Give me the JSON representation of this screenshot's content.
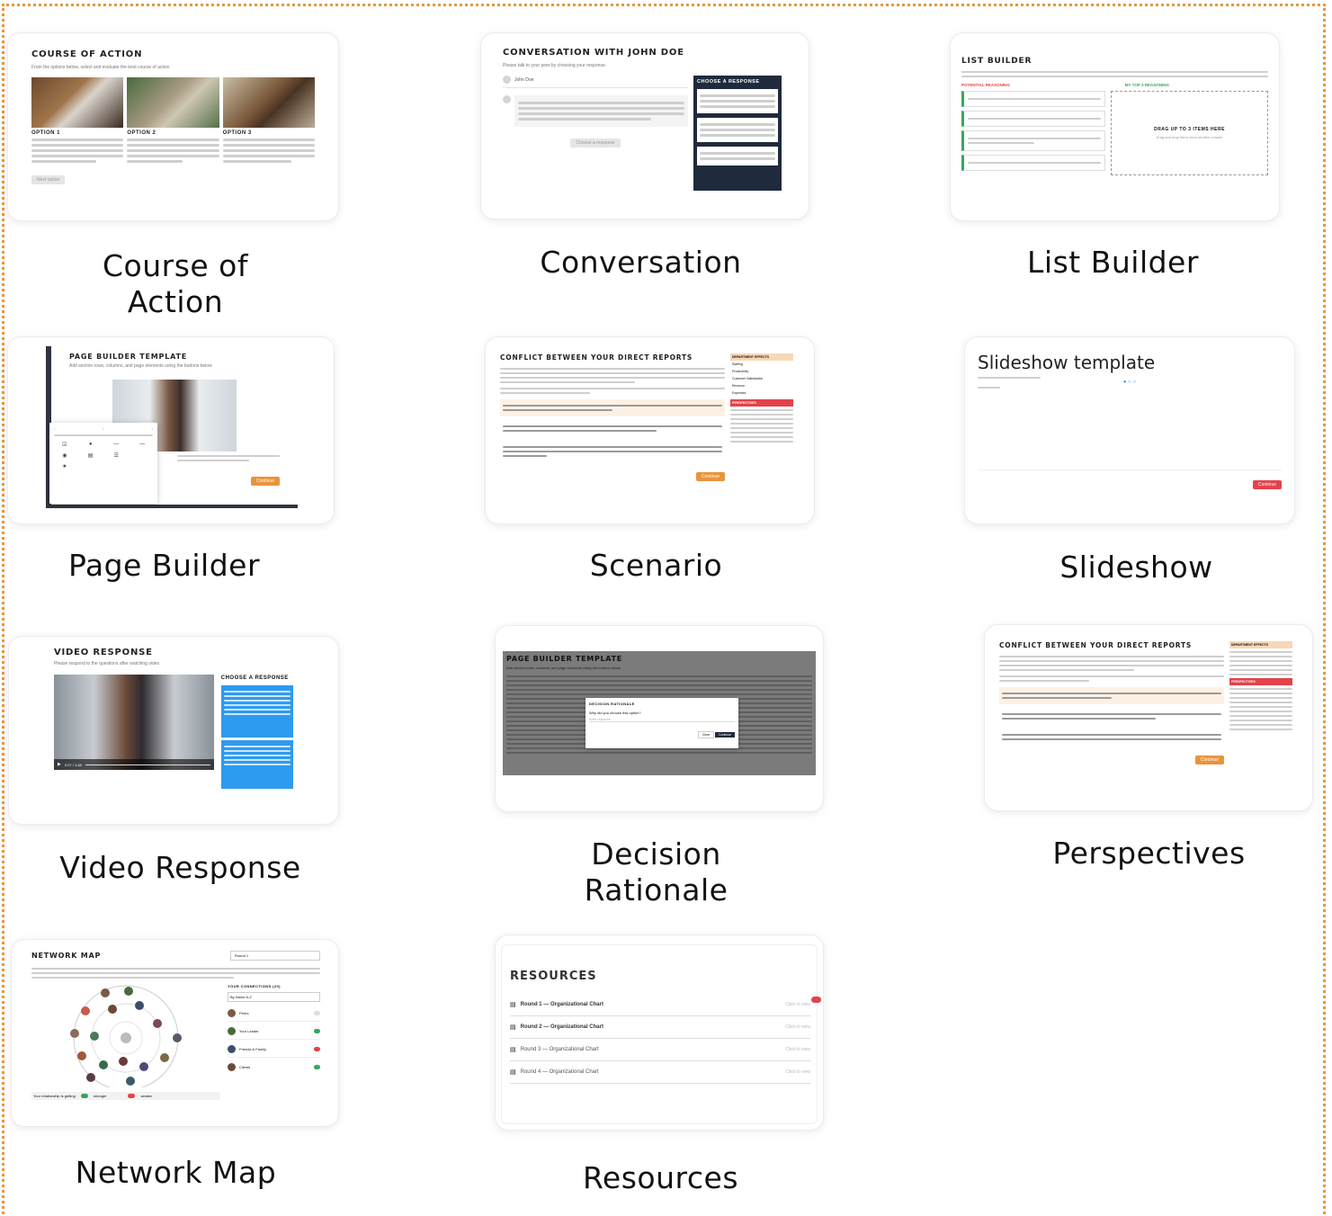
{
  "tiles": {
    "course_of_action": {
      "caption_l1": "Course of",
      "caption_l2": "Action",
      "preview_title": "COURSE OF ACTION",
      "preview_sub": "From the options below, select and evaluate the best course of action",
      "options": [
        "OPTION 1",
        "OPTION 2",
        "OPTION 3"
      ],
      "button": "Next option"
    },
    "conversation": {
      "caption": "Conversation",
      "preview_title": "CONVERSATION WITH JOHN DOE",
      "preview_sub": "Please talk to your peer by choosing your response.",
      "speaker": "John Doe",
      "choose_label": "CHOOSE A RESPONSE",
      "choose_button": "Choose a response"
    },
    "list_builder": {
      "caption": "List Builder",
      "preview_title": "LIST BUILDER",
      "left_label": "POTENTIAL REASONING",
      "right_label": "MY TOP 3 REASONING",
      "drop_title": "DRAG UP TO 3 ITEMS HERE",
      "drop_sub": "Drag and drop items from another column"
    },
    "page_builder": {
      "caption": "Page Builder",
      "preview_title": "PAGE BUILDER TEMPLATE",
      "preview_sub": "Add section rows, columns, and page elements using the buttons below",
      "button": "Continue"
    },
    "scenario": {
      "caption": "Scenario",
      "preview_title": "CONFLICT BETWEEN YOUR DIRECT REPORTS",
      "side_header": "DEPARTMENT EFFECTS",
      "side_items": [
        "Staffing",
        "Productivity",
        "Customer Satisfaction",
        "Revenue",
        "Expenses"
      ],
      "persp_header": "PERSPECTIVES",
      "button": "Continue"
    },
    "slideshow": {
      "caption": "Slideshow",
      "preview_title": "Slideshow template",
      "button": "Continue"
    },
    "video_response": {
      "caption": "Video Response",
      "preview_title": "VIDEO RESPONSE",
      "preview_sub": "Please respond to the questions after watching video",
      "choose_label": "CHOOSE A RESPONSE",
      "time": "0:27 / 1:48"
    },
    "decision_rationale": {
      "caption_l1": "Decision",
      "caption_l2": "Rationale",
      "preview_title": "PAGE BUILDER TEMPLATE",
      "preview_sub": "Add section rows, columns, and page elements using the buttons below",
      "modal_title": "DECISION RATIONALE",
      "modal_question": "Why did you choose this option?",
      "modal_placeholder": "Enter response",
      "btn_clear": "Clear",
      "btn_continue": "Continue"
    },
    "perspectives": {
      "caption": "Perspectives",
      "preview_title": "CONFLICT BETWEEN YOUR DIRECT REPORTS",
      "side_header": "DEPARTMENT EFFECTS",
      "persp_header": "PERSPECTIVES",
      "button": "Continue"
    },
    "network_map": {
      "caption": "Network Map",
      "preview_title": "NETWORK MAP",
      "round_label": "Round 1",
      "connections_label": "YOUR CONNECTIONS (20)",
      "sort_label": "By Name A-Z",
      "rows": [
        "Peers",
        "Your Leader",
        "Friends & Family",
        "Clients"
      ],
      "legend_left": "Your relationship is getting",
      "legend_mid": "stronger",
      "legend_right": "weaker"
    },
    "resources": {
      "caption": "Resources",
      "preview_title": "RESOURCES",
      "items": [
        "Round 1 — Organizational Chart",
        "Round 2 — Organizational Chart",
        "Round 3 — Organizational Chart",
        "Round 4 — Organizational Chart"
      ],
      "view_label": "Click to view"
    }
  },
  "colors": {
    "accent": "#e8953c",
    "blue": "#2d9bf0",
    "red": "#e2434b",
    "frame": "#e9963b"
  }
}
